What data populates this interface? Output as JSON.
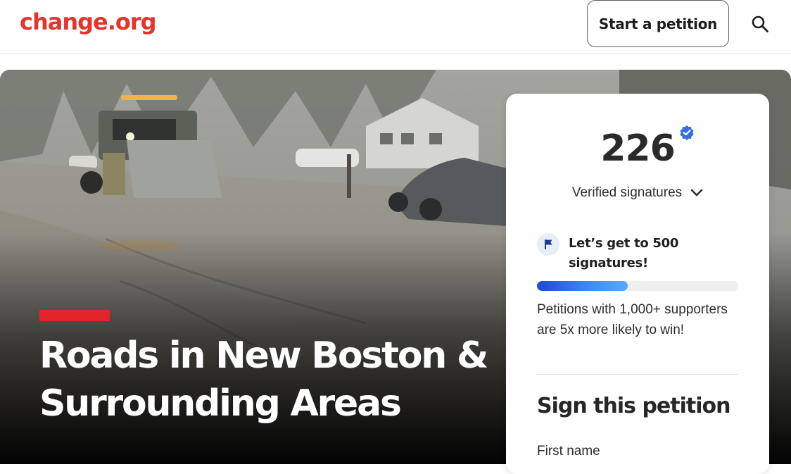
{
  "header": {
    "logo": "change.org",
    "start_petition_label": "Start a petition",
    "search_icon": "search-icon"
  },
  "hero": {
    "title": "Roads in New Boston & Surrounding Areas",
    "image_description_icon": "hero-photo"
  },
  "signature_card": {
    "count": "226",
    "verified_icon": "verified-badge-icon",
    "signatures_label": "Verified signatures",
    "dropdown_icon": "chevron-down-icon",
    "goal_icon": "flag-icon",
    "goal_text": "Let’s get to 500 signatures!",
    "progress_fraction": 0.452,
    "note": "Petitions with 1,000+ supporters are 5x more likely to win!",
    "sign_heading": "Sign this petition",
    "first_name_label": "First name"
  },
  "colors": {
    "brand": "#e5352b",
    "red_bar": "#e3242b",
    "progress_start": "#1f49d6",
    "progress_end": "#5aa9f7",
    "verified": "#2f6fe0"
  }
}
